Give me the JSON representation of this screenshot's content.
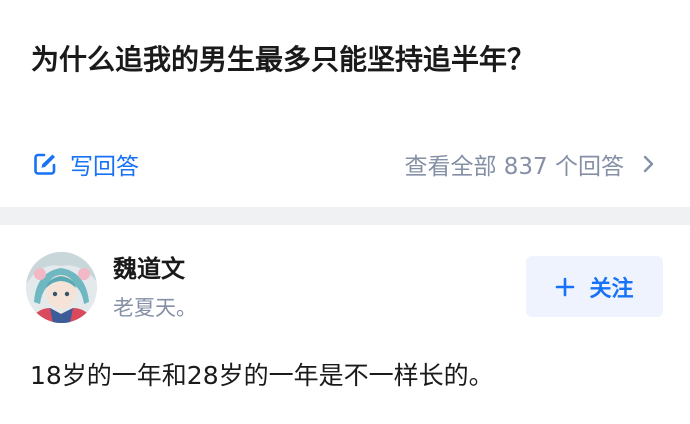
{
  "question": {
    "title": "为什么追我的男生最多只能坚持追半年？"
  },
  "actions": {
    "write_answer_label": "写回答",
    "write_answer_icon": "edit-icon",
    "view_all_label": "查看全部 837 个回答",
    "view_all_icon": "chevron-right-icon"
  },
  "answer": {
    "author": {
      "name": "魏道文",
      "bio": "老夏天。",
      "avatar": "avatar-image"
    },
    "follow": {
      "label": "关注",
      "icon": "plus-icon"
    },
    "text": "18岁的一年和28岁的一年是不一样长的。"
  },
  "colors": {
    "accent": "#1772f6",
    "muted": "#8590a6",
    "text": "#1a1a1a",
    "follow_bg": "#eef3fd",
    "divider": "#f0f1f3"
  }
}
